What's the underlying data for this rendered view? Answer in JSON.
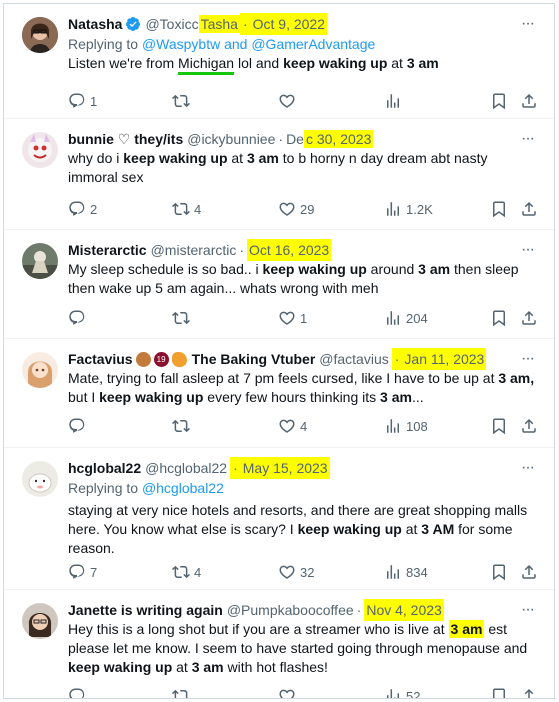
{
  "tweets": [
    {
      "name": "Natasha",
      "verified": true,
      "handle": "@Toxicc",
      "handle_hl": "Tasha",
      "date": "Oct 9, 2022",
      "reply_prefix": "Replying to ",
      "reply_to": "@Waspybtw and @GamerAdvantage",
      "text_parts": [
        "Listen we're from ",
        "Michigan",
        " lol and ",
        "keep waking up",
        " at ",
        "3 am"
      ],
      "replies": "1",
      "retweets": "",
      "likes": "",
      "views": ""
    },
    {
      "name": "bunnie ♡ they/its",
      "handle": "@ickybunniee",
      "date_pre": "De",
      "date_hl": "c 30, 2023",
      "text_parts": [
        "why do i ",
        "keep waking up",
        " at ",
        "3 am",
        " to b horny n day dream abt nasty immoral sex"
      ],
      "replies": "2",
      "retweets": "4",
      "likes": "29",
      "views": "1.2K"
    },
    {
      "name": "Misterarctic",
      "handle": "@misterarctic",
      "date": "Oct 16, 2023",
      "text_parts": [
        "My sleep schedule is so bad.. i ",
        "keep waking up",
        " around ",
        "3 am",
        " then sleep then wake up 5 am again... whats wrong with meh"
      ],
      "replies": "",
      "retweets": "",
      "likes": "1",
      "views": "204"
    },
    {
      "name": "Factavius",
      "name_extra": "The Baking Vtuber",
      "handle": "@factavius",
      "date": "Jan 11, 2023",
      "text_parts": [
        "Mate, trying to fall asleep at 7 pm feels cursed, like I have to be up at ",
        "3 am,",
        " but I ",
        "keep waking up",
        " every few hours thinking its ",
        "3 am",
        "..."
      ],
      "replies": "",
      "retweets": "",
      "likes": "4",
      "views": "108"
    },
    {
      "name": "hcglobal22",
      "handle": "@hcglobal22",
      "date": "May 15, 2023",
      "reply_prefix": "Replying to ",
      "reply_to": "@hcglobal22",
      "text_parts": [
        "staying at very nice hotels and resorts, and there are great shopping malls here. You know what else is scary? I ",
        "keep waking up",
        " at ",
        "3 AM",
        " for some reason."
      ],
      "replies": "7",
      "retweets": "4",
      "likes": "32",
      "views": "834"
    },
    {
      "name": "Janette is writing again",
      "handle": "@Pumpkaboocoffee",
      "date": "Nov 4, 2023",
      "text_parts": [
        "Hey this is a long shot but if you are a streamer who is live at ",
        "3 am",
        " est please let me know. I seem to have started going through menopause and ",
        "keep waking up",
        " at ",
        "3 am",
        " with hot flashes!"
      ],
      "replies": "",
      "retweets": "",
      "likes": "",
      "views": "52"
    }
  ],
  "colors": {
    "highlight": "#ffff00",
    "link": "#1d9bf0",
    "muted": "#536471",
    "underline": "#16c60c"
  },
  "icons": [
    "reply-icon",
    "retweet-icon",
    "like-icon",
    "views-icon",
    "bookmark-icon",
    "share-icon",
    "more-icon",
    "verified-icon"
  ]
}
